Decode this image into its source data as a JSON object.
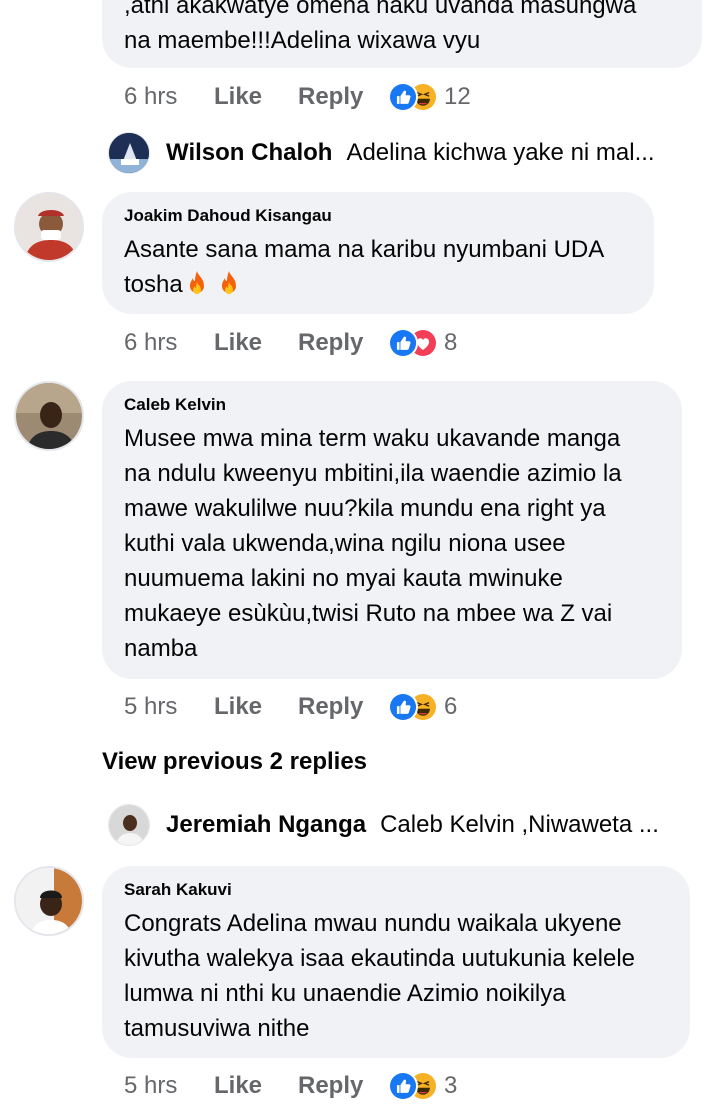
{
  "comment0": {
    "text": ",athi akakwatye omena naku uvanda masungwa\nna maembe!!!Adelina wixawa vyu",
    "time": "6 hrs",
    "like": "Like",
    "reply": "Reply",
    "reactions": [
      "like-icon",
      "laughing-icon"
    ],
    "count": "12"
  },
  "reply_wilson": {
    "name": "Wilson Chaloh",
    "text": "Adelina kichwa yake ni mal..."
  },
  "comment1": {
    "name": "Joakim Dahoud Kisangau",
    "text": "Asante sana mama na karibu nyumbani UDA\ntosha",
    "emoji": [
      "fire-icon",
      "fire-icon"
    ],
    "time": "6 hrs",
    "like": "Like",
    "reply": "Reply",
    "reactions": [
      "like-icon",
      "love-icon"
    ],
    "count": "8"
  },
  "comment2": {
    "name": "Caleb Kelvin",
    "text": "Musee mwa mina term waku ukavande manga\nna ndulu kweenyu mbitini,ila waendie azimio la\nmawe wakulilwe nuu?kila mundu ena right ya\nkuthi vala ukwenda,wina ngilu niona usee\nnuumuema lakini no myai kauta mwinuke\nmukaeye esùkùu,twisi Ruto na mbee wa Z vai\nnamba",
    "time": "5 hrs",
    "like": "Like",
    "reply": "Reply",
    "reactions": [
      "like-icon",
      "laughing-icon"
    ],
    "count": "6"
  },
  "view_previous": "View previous 2 replies",
  "reply_jeremiah": {
    "name": "Jeremiah Nganga",
    "text": "Caleb Kelvin ,Niwaweta ..."
  },
  "comment3": {
    "name": "Sarah Kakuvi",
    "text": "Congrats Adelina mwau nundu waikala ukyene\nkivutha walekya isaa ekautinda uutukunia kelele\nlumwa ni nthi ku unaendie Azimio noikilya\ntamusuviwa nithe",
    "time": "5 hrs",
    "like": "Like",
    "reply": "Reply",
    "reactions": [
      "like-icon",
      "laughing-icon"
    ],
    "count": "3"
  },
  "colors": {
    "bubble": "#f0f2f5",
    "meta": "#65676b",
    "like_blue": "#1877f2",
    "love_red": "#f33e58",
    "haha_yellow": "#f7b125"
  }
}
